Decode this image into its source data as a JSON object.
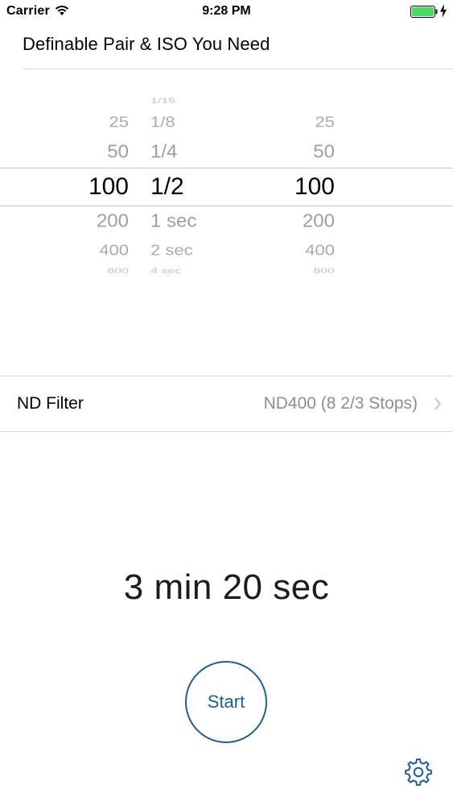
{
  "status_bar": {
    "carrier": "Carrier",
    "time": "9:28 PM",
    "battery_color": "#4cd964"
  },
  "header": {
    "title": "Definable Pair & ISO You Need"
  },
  "picker": {
    "iso_column": [
      "25",
      "50",
      "100",
      "200",
      "400",
      "800"
    ],
    "shutter_column": [
      "1/15",
      "1/8",
      "1/4",
      "1/2",
      "1 sec",
      "2 sec",
      "4 sec"
    ],
    "target_iso_column": [
      "25",
      "50",
      "100",
      "200",
      "400",
      "800"
    ],
    "selected": {
      "iso": "100",
      "shutter": "1/2",
      "target_iso": "100"
    }
  },
  "nd_filter": {
    "label": "ND Filter",
    "value": "ND400 (8 2/3 Stops)"
  },
  "result": {
    "exposure_time": "3 min 20 sec"
  },
  "actions": {
    "start_label": "Start",
    "accent_color": "#1d5f8f"
  },
  "icons": {
    "wifi": "wifi-icon",
    "battery": "battery-icon",
    "charging": "bolt-icon",
    "chevron": "chevron-right-icon",
    "settings": "gear-icon"
  }
}
